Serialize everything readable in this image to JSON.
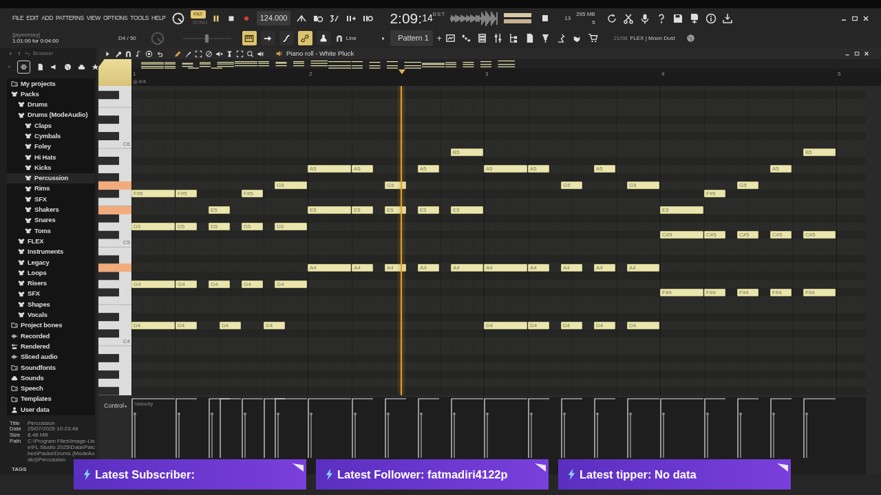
{
  "menu": [
    "FILE",
    "EDIT",
    "ADD",
    "PATTERNS",
    "VIEW",
    "OPTIONS",
    "TOOLS",
    "HELP"
  ],
  "hint": {
    "user": "[jayworsey]",
    "text": "1:01:00 for 0:04:00"
  },
  "note_readout": "D4 / 50",
  "pitch_slider": {
    "level": 0.5
  },
  "mode_toggle": [
    {
      "label": "PAT",
      "selected": true
    },
    {
      "label": "SONG",
      "selected": false
    }
  ],
  "transport": {
    "playing": true
  },
  "tempo": "124.000",
  "clock": {
    "main": "2:09:",
    "sub": "14",
    "unit": "B:S:T"
  },
  "cpu": {
    "voices": "13",
    "memory": "295 MB",
    "polyphony": "6"
  },
  "tool_buttons": [
    {
      "kind": "keys",
      "on": true
    },
    {
      "kind": "arrow",
      "on": false
    },
    {
      "kind": "curve",
      "on": false
    },
    {
      "kind": "link",
      "on": true
    },
    {
      "kind": "stamp",
      "on": false
    }
  ],
  "snap": "Line",
  "pattern": "Pattern 1",
  "add_pattern": "+",
  "news": {
    "date": "21/08",
    "text": "FLEX | Moon Dust"
  },
  "browser": {
    "title": "Browser",
    "tree": [
      {
        "label": "My projects",
        "kind": "folder",
        "selected": false
      },
      {
        "label": "Packs",
        "kind": "pack",
        "selected": false,
        "children": [
          {
            "label": "Drums",
            "kind": "pack",
            "selected": false
          },
          {
            "label": "Drums (ModeAudio)",
            "kind": "pack",
            "selected": false,
            "children": [
              {
                "label": "Claps",
                "kind": "pack",
                "selected": false
              },
              {
                "label": "Cymbals",
                "kind": "pack",
                "selected": false
              },
              {
                "label": "Foley",
                "kind": "pack",
                "selected": false
              },
              {
                "label": "Hi Hats",
                "kind": "pack",
                "selected": false
              },
              {
                "label": "Kicks",
                "kind": "pack",
                "selected": false
              },
              {
                "label": "Percussion",
                "kind": "pack",
                "selected": true
              },
              {
                "label": "Rims",
                "kind": "pack",
                "selected": false
              },
              {
                "label": "SFX",
                "kind": "pack",
                "selected": false
              },
              {
                "label": "Shakers",
                "kind": "pack",
                "selected": false
              },
              {
                "label": "Snares",
                "kind": "pack",
                "selected": false
              },
              {
                "label": "Toms",
                "kind": "pack",
                "selected": false
              }
            ]
          },
          {
            "label": "FLEX",
            "kind": "pack",
            "selected": false
          },
          {
            "label": "Instruments",
            "kind": "pack",
            "selected": false
          },
          {
            "label": "Legacy",
            "kind": "pack",
            "selected": false
          },
          {
            "label": "Loops",
            "kind": "pack",
            "selected": false
          },
          {
            "label": "Risers",
            "kind": "pack",
            "selected": false
          },
          {
            "label": "SFX",
            "kind": "pack",
            "selected": false
          },
          {
            "label": "Shapes",
            "kind": "pack",
            "selected": false
          },
          {
            "label": "Vocals",
            "kind": "pack",
            "selected": false
          }
        ]
      },
      {
        "label": "Project bones",
        "kind": "folder",
        "selected": false
      },
      {
        "label": "Recorded",
        "kind": "audio",
        "selected": false
      },
      {
        "label": "Rendered",
        "kind": "rendered",
        "selected": false
      },
      {
        "label": "Sliced audio",
        "kind": "audio",
        "selected": false
      },
      {
        "label": "Soundfonts",
        "kind": "folder",
        "selected": false
      },
      {
        "label": "Sounds",
        "kind": "cloud",
        "selected": false
      },
      {
        "label": "Speech",
        "kind": "folder",
        "selected": false
      },
      {
        "label": "Templates",
        "kind": "folder",
        "selected": false
      },
      {
        "label": "User data",
        "kind": "user",
        "selected": false
      }
    ]
  },
  "file_info": [
    {
      "label": "Title",
      "value": "Percussion"
    },
    {
      "label": "Date",
      "value": "25/07/2025 10:23:48"
    },
    {
      "label": "Size",
      "value": "8.48 MB"
    },
    {
      "label": "Path",
      "value": "C:\\Program Files\\Image-Line\\FL Studio 2025\\Data\\Patches\\Packs\\Drums (ModeAudio)\\Percussion"
    }
  ],
  "tags_label": "TAGS",
  "piano_roll": {
    "title": "Piano roll - White Pluck",
    "bars": [
      "1",
      "2",
      "3",
      "4",
      "5"
    ],
    "time_signature": "4/4",
    "playhead": {
      "level": 0.383
    },
    "key_labels": [
      "C6",
      "C5",
      "C4"
    ],
    "note_rows": [
      {
        "key_pressed": false,
        "notes": [
          "B5",
          "B5"
        ]
      },
      {
        "key_pressed": false,
        "notes": [
          "A5",
          "A5",
          "A5",
          "A5",
          "A5",
          "A5",
          "A5"
        ]
      },
      {
        "key_pressed": true,
        "notes": [
          "G5",
          "G5",
          "G5",
          "G5",
          "G5"
        ]
      },
      {
        "key_pressed": false,
        "notes": [
          "F#5",
          "F#5",
          "F#5",
          "F#5"
        ]
      },
      {
        "key_pressed": true,
        "notes": [
          "E5",
          "E5",
          "E5",
          "E5",
          "E5",
          "E5",
          "E5"
        ]
      },
      {
        "key_pressed": false,
        "notes": [
          "D5",
          "D5",
          "D5",
          "D5",
          "D5"
        ]
      },
      {
        "key_pressed": false,
        "notes": [
          "C#5",
          "C#5",
          "C#5",
          "C#5",
          "C#5"
        ]
      },
      {
        "key_pressed": true,
        "notes": [
          "A4",
          "A4",
          "A4",
          "A4",
          "A4",
          "A4",
          "A4",
          "A4",
          "A4",
          "A4"
        ]
      },
      {
        "key_pressed": false,
        "notes": [
          "G4",
          "G4",
          "G4",
          "G4",
          "G4"
        ]
      },
      {
        "key_pressed": false,
        "notes": [
          "F#4",
          "F#4",
          "F#4",
          "F#4",
          "F#4"
        ]
      },
      {
        "key_pressed": false,
        "notes": [
          "D4",
          "D4",
          "D4",
          "D4",
          "D4",
          "D4",
          "D4",
          "D4",
          "D4"
        ]
      }
    ],
    "control_label": "Control",
    "control_target": "Velocity"
  },
  "banners": [
    {
      "label": "Latest Subscriber:"
    },
    {
      "label": "Latest Follower: fatmadiri4122p"
    },
    {
      "label": "Latest tipper: No data"
    }
  ]
}
